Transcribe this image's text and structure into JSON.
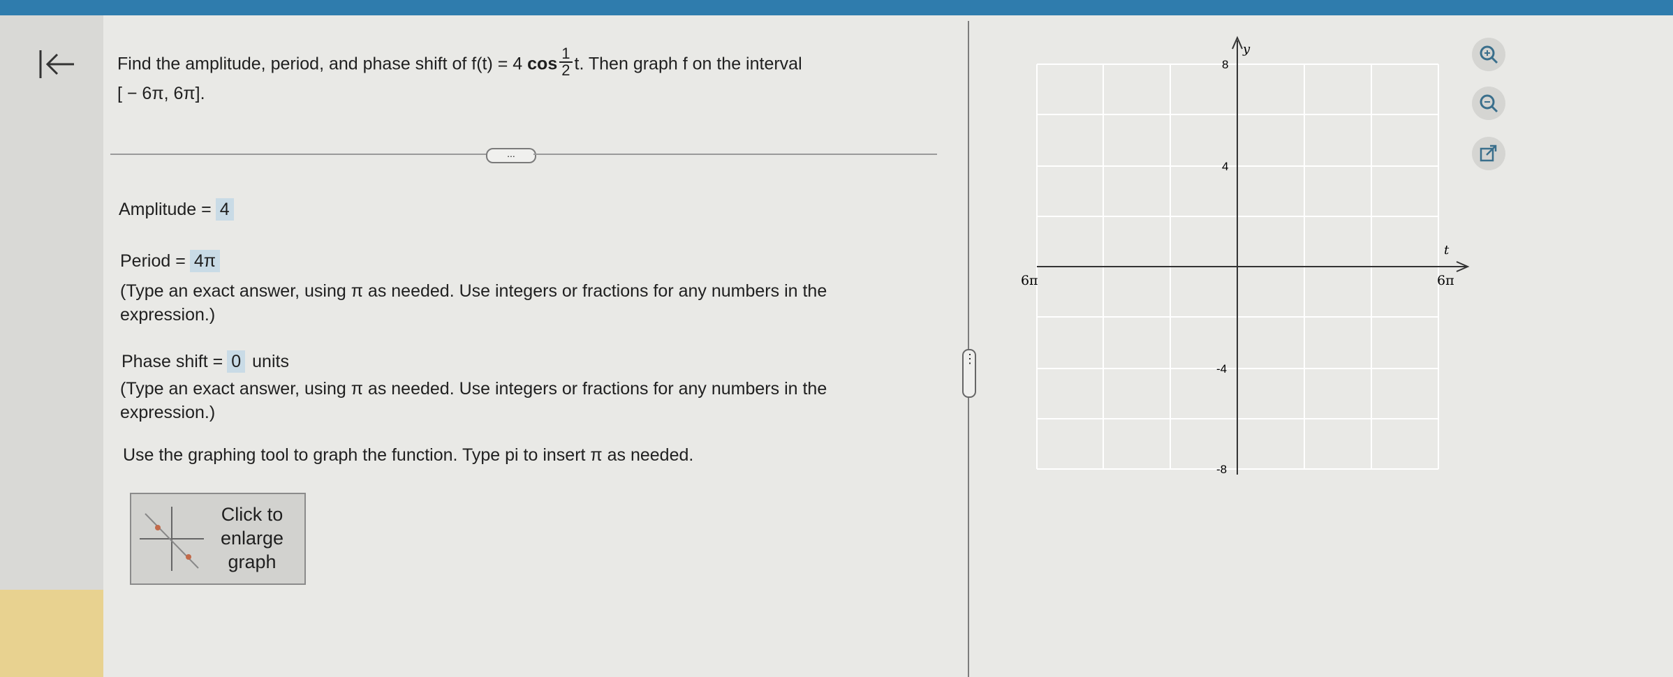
{
  "question": {
    "prefix": "Find the amplitude, period, and phase shift of f(t) = 4",
    "cos": "cos",
    "frac_num": "1",
    "frac_den": "2",
    "suffix": "t. Then graph f on the interval",
    "interval": "[ − 6π, 6π]."
  },
  "more_button": "...",
  "amplitude": {
    "label": "Amplitude =",
    "value": "4"
  },
  "period": {
    "label": "Period =",
    "value": "4π",
    "hint": "(Type an exact answer, using π as needed. Use integers or fractions for any numbers in the expression.)"
  },
  "phase_shift": {
    "label": "Phase shift =",
    "value": "0",
    "unit": "units",
    "hint": "(Type an exact answer, using π as needed. Use integers or fractions for any numbers in the expression.)"
  },
  "instruction": "Use the graphing tool to graph the function. Type pi to insert π as needed.",
  "enlarge_button": "Click to enlarge graph",
  "splitter": "⋮",
  "graph": {
    "y_axis_label": "y",
    "x_axis_label": "t",
    "x_min_label": "− 6π",
    "x_max_label": "6π",
    "y_tick_labels": [
      "8",
      "4",
      "-4",
      "-8"
    ],
    "x_range": [
      "-6π",
      "6π"
    ],
    "y_range": [
      -8,
      8
    ],
    "grid": true,
    "grid_color": "#ffffff"
  },
  "tools": [
    {
      "icon": "zoom-in-icon"
    },
    {
      "icon": "zoom-out-icon"
    },
    {
      "icon": "external-link-icon"
    }
  ],
  "colors": {
    "top_bar": "#2f7cad",
    "answer_box": "#c9dbe6",
    "left_accent": "#e8d290"
  }
}
